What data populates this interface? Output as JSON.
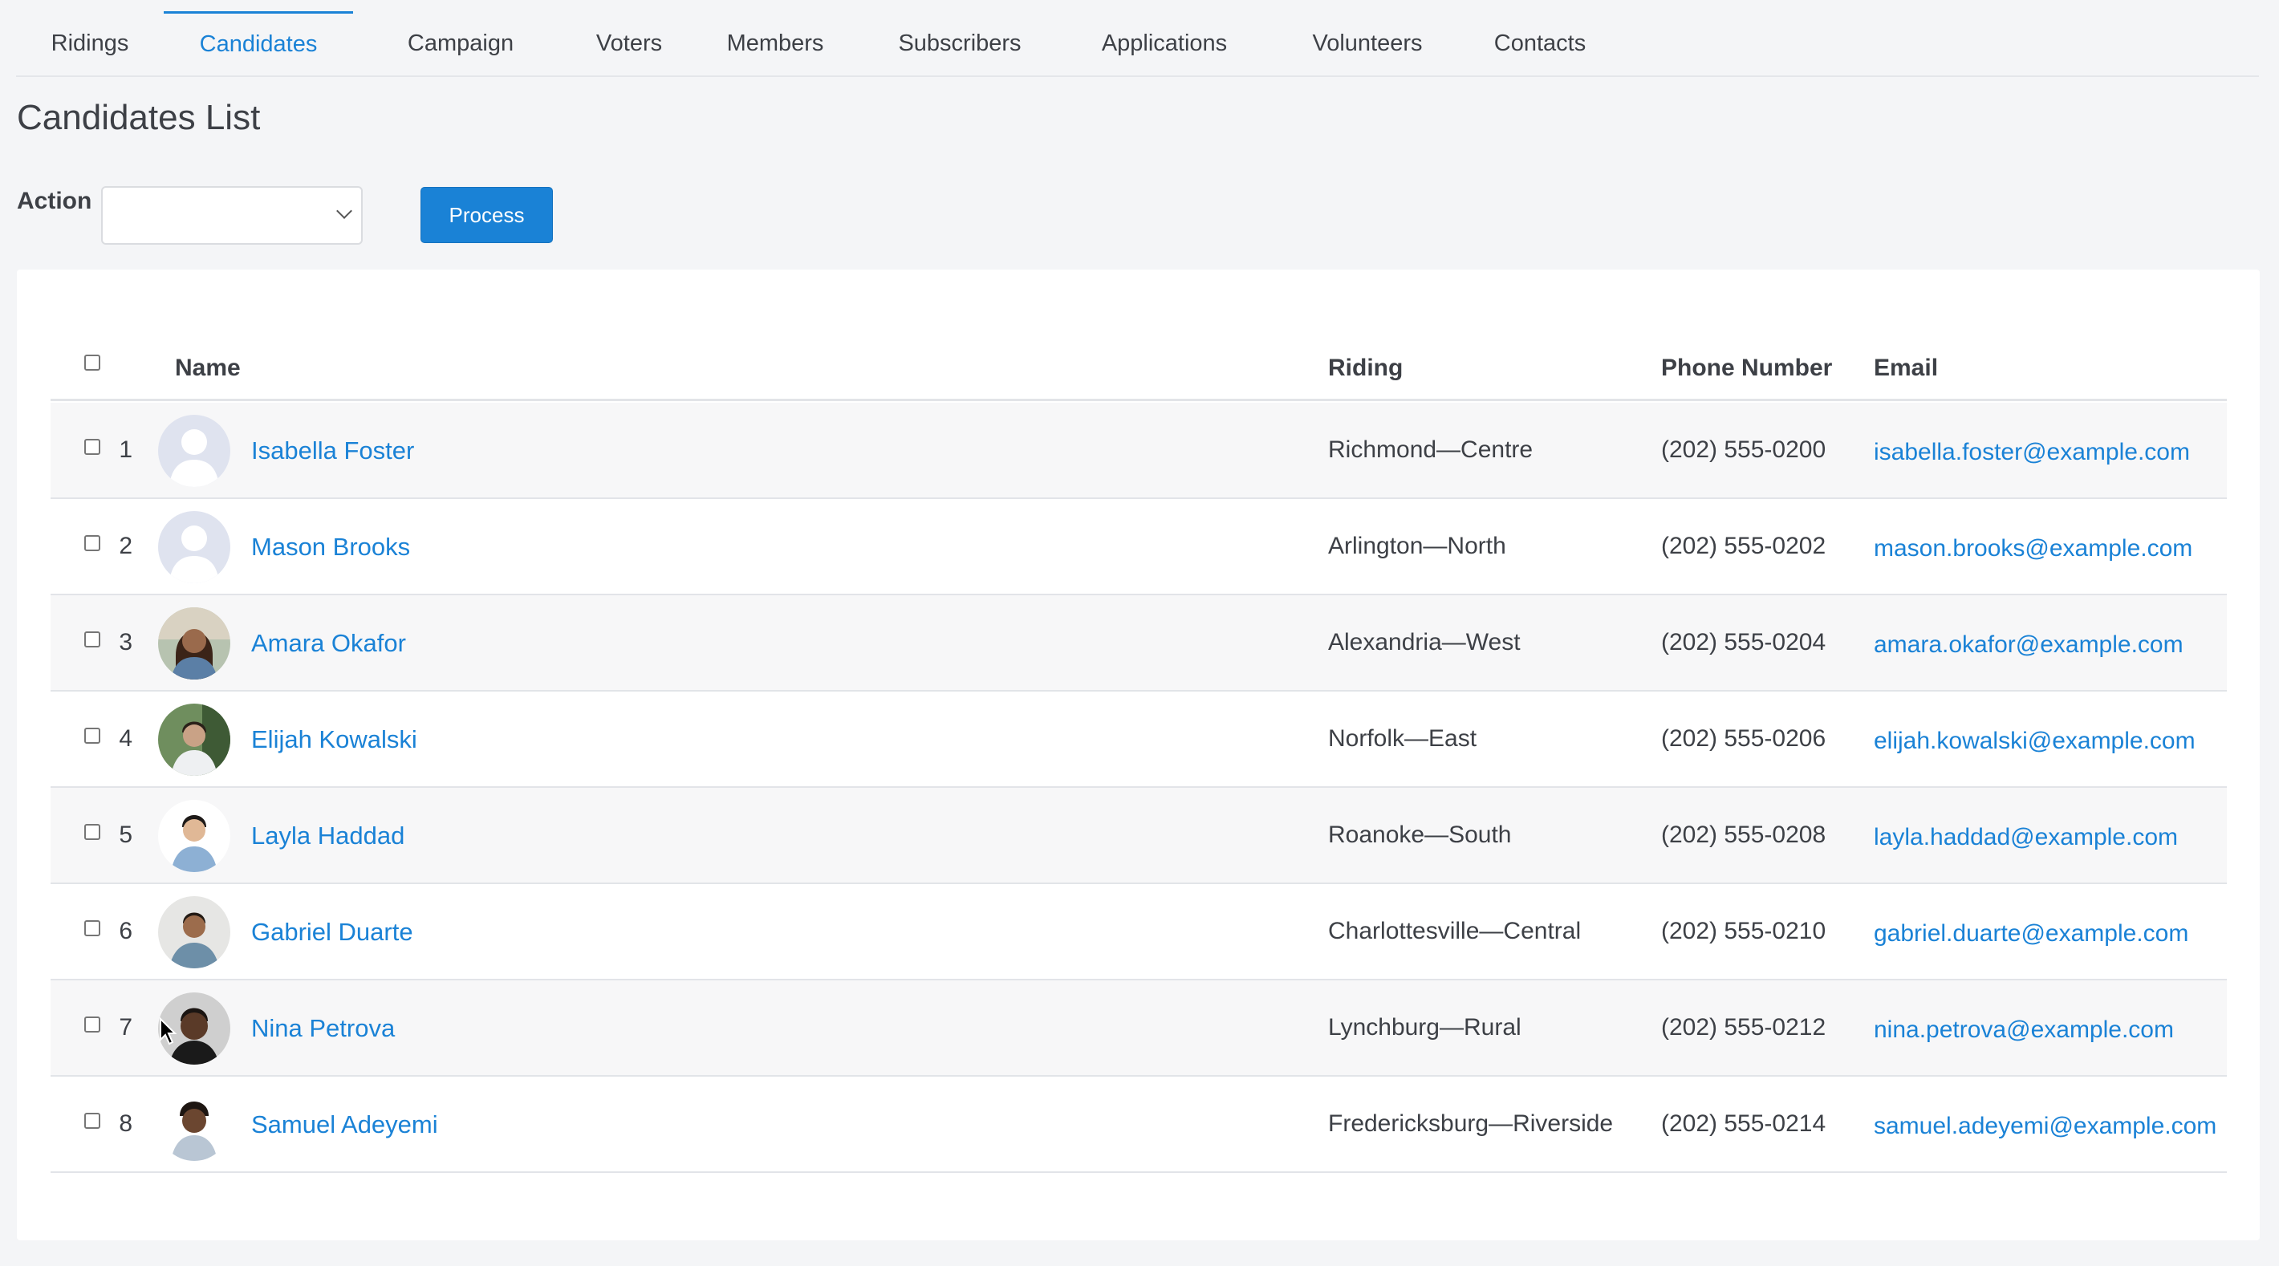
{
  "tabs": [
    {
      "label": "Ridings"
    },
    {
      "label": "Candidates",
      "active": true
    },
    {
      "label": "Campaign"
    },
    {
      "label": "Voters"
    },
    {
      "label": "Members"
    },
    {
      "label": "Subscribers"
    },
    {
      "label": "Applications"
    },
    {
      "label": "Volunteers"
    },
    {
      "label": "Contacts"
    }
  ],
  "page": {
    "title": "Candidates List"
  },
  "action": {
    "label": "Action",
    "selected": "",
    "process_label": "Process"
  },
  "table": {
    "headers": {
      "name": "Name",
      "riding": "Riding",
      "phone": "Phone Number",
      "email": "Email"
    },
    "rows": [
      {
        "index": "1",
        "name": "Isabella Foster",
        "riding": "Richmond—Centre",
        "phone": "(202) 555-0200",
        "email": "isabella.foster@example.com",
        "avatar": "placeholder-icon"
      },
      {
        "index": "2",
        "name": "Mason Brooks",
        "riding": "Arlington—North",
        "phone": "(202) 555-0202",
        "email": "mason.brooks@example.com",
        "avatar": "placeholder-icon"
      },
      {
        "index": "3",
        "name": "Amara Okafor",
        "riding": "Alexandria—West",
        "phone": "(202) 555-0204",
        "email": "amara.okafor@example.com",
        "avatar": "photo"
      },
      {
        "index": "4",
        "name": "Elijah Kowalski",
        "riding": "Norfolk—East",
        "phone": "(202) 555-0206",
        "email": "elijah.kowalski@example.com",
        "avatar": "photo"
      },
      {
        "index": "5",
        "name": "Layla Haddad",
        "riding": "Roanoke—South",
        "phone": "(202) 555-0208",
        "email": "layla.haddad@example.com",
        "avatar": "photo"
      },
      {
        "index": "6",
        "name": "Gabriel Duarte",
        "riding": "Charlottesville—Central",
        "phone": "(202) 555-0210",
        "email": "gabriel.duarte@example.com",
        "avatar": "photo"
      },
      {
        "index": "7",
        "name": "Nina Petrova",
        "riding": "Lynchburg—Rural",
        "phone": "(202) 555-0212",
        "email": "nina.petrova@example.com",
        "avatar": "photo"
      },
      {
        "index": "8",
        "name": "Samuel Adeyemi",
        "riding": "Fredericksburg—Riverside",
        "phone": "(202) 555-0214",
        "email": "samuel.adeyemi@example.com",
        "avatar": "photo"
      }
    ]
  },
  "colors": {
    "accent": "#1a82d6",
    "text": "#3d4046",
    "background": "#f4f5f7"
  }
}
